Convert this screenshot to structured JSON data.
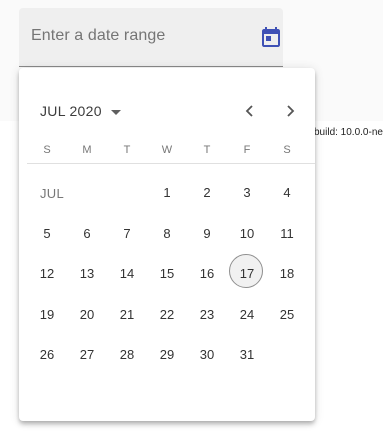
{
  "date_field": {
    "placeholder": "Enter a date range",
    "icon": "calendar-icon",
    "icon_color": "#3f51b5"
  },
  "build_info": "build: 10.0.0-ne",
  "calendar": {
    "period_label": "JUL 2020",
    "month_label": "JUL",
    "weekdays": [
      "S",
      "M",
      "T",
      "W",
      "T",
      "F",
      "S"
    ],
    "today": "17",
    "weeks": [
      [
        "",
        "",
        "",
        "1",
        "2",
        "3",
        "4"
      ],
      [
        "5",
        "6",
        "7",
        "8",
        "9",
        "10",
        "11"
      ],
      [
        "12",
        "13",
        "14",
        "15",
        "16",
        "17",
        "18"
      ],
      [
        "19",
        "20",
        "21",
        "22",
        "23",
        "24",
        "25"
      ],
      [
        "26",
        "27",
        "28",
        "29",
        "30",
        "31",
        ""
      ]
    ],
    "prev_icon": "chevron-left-icon",
    "next_icon": "chevron-right-icon",
    "period_toggle_icon": "caret-down-icon"
  }
}
